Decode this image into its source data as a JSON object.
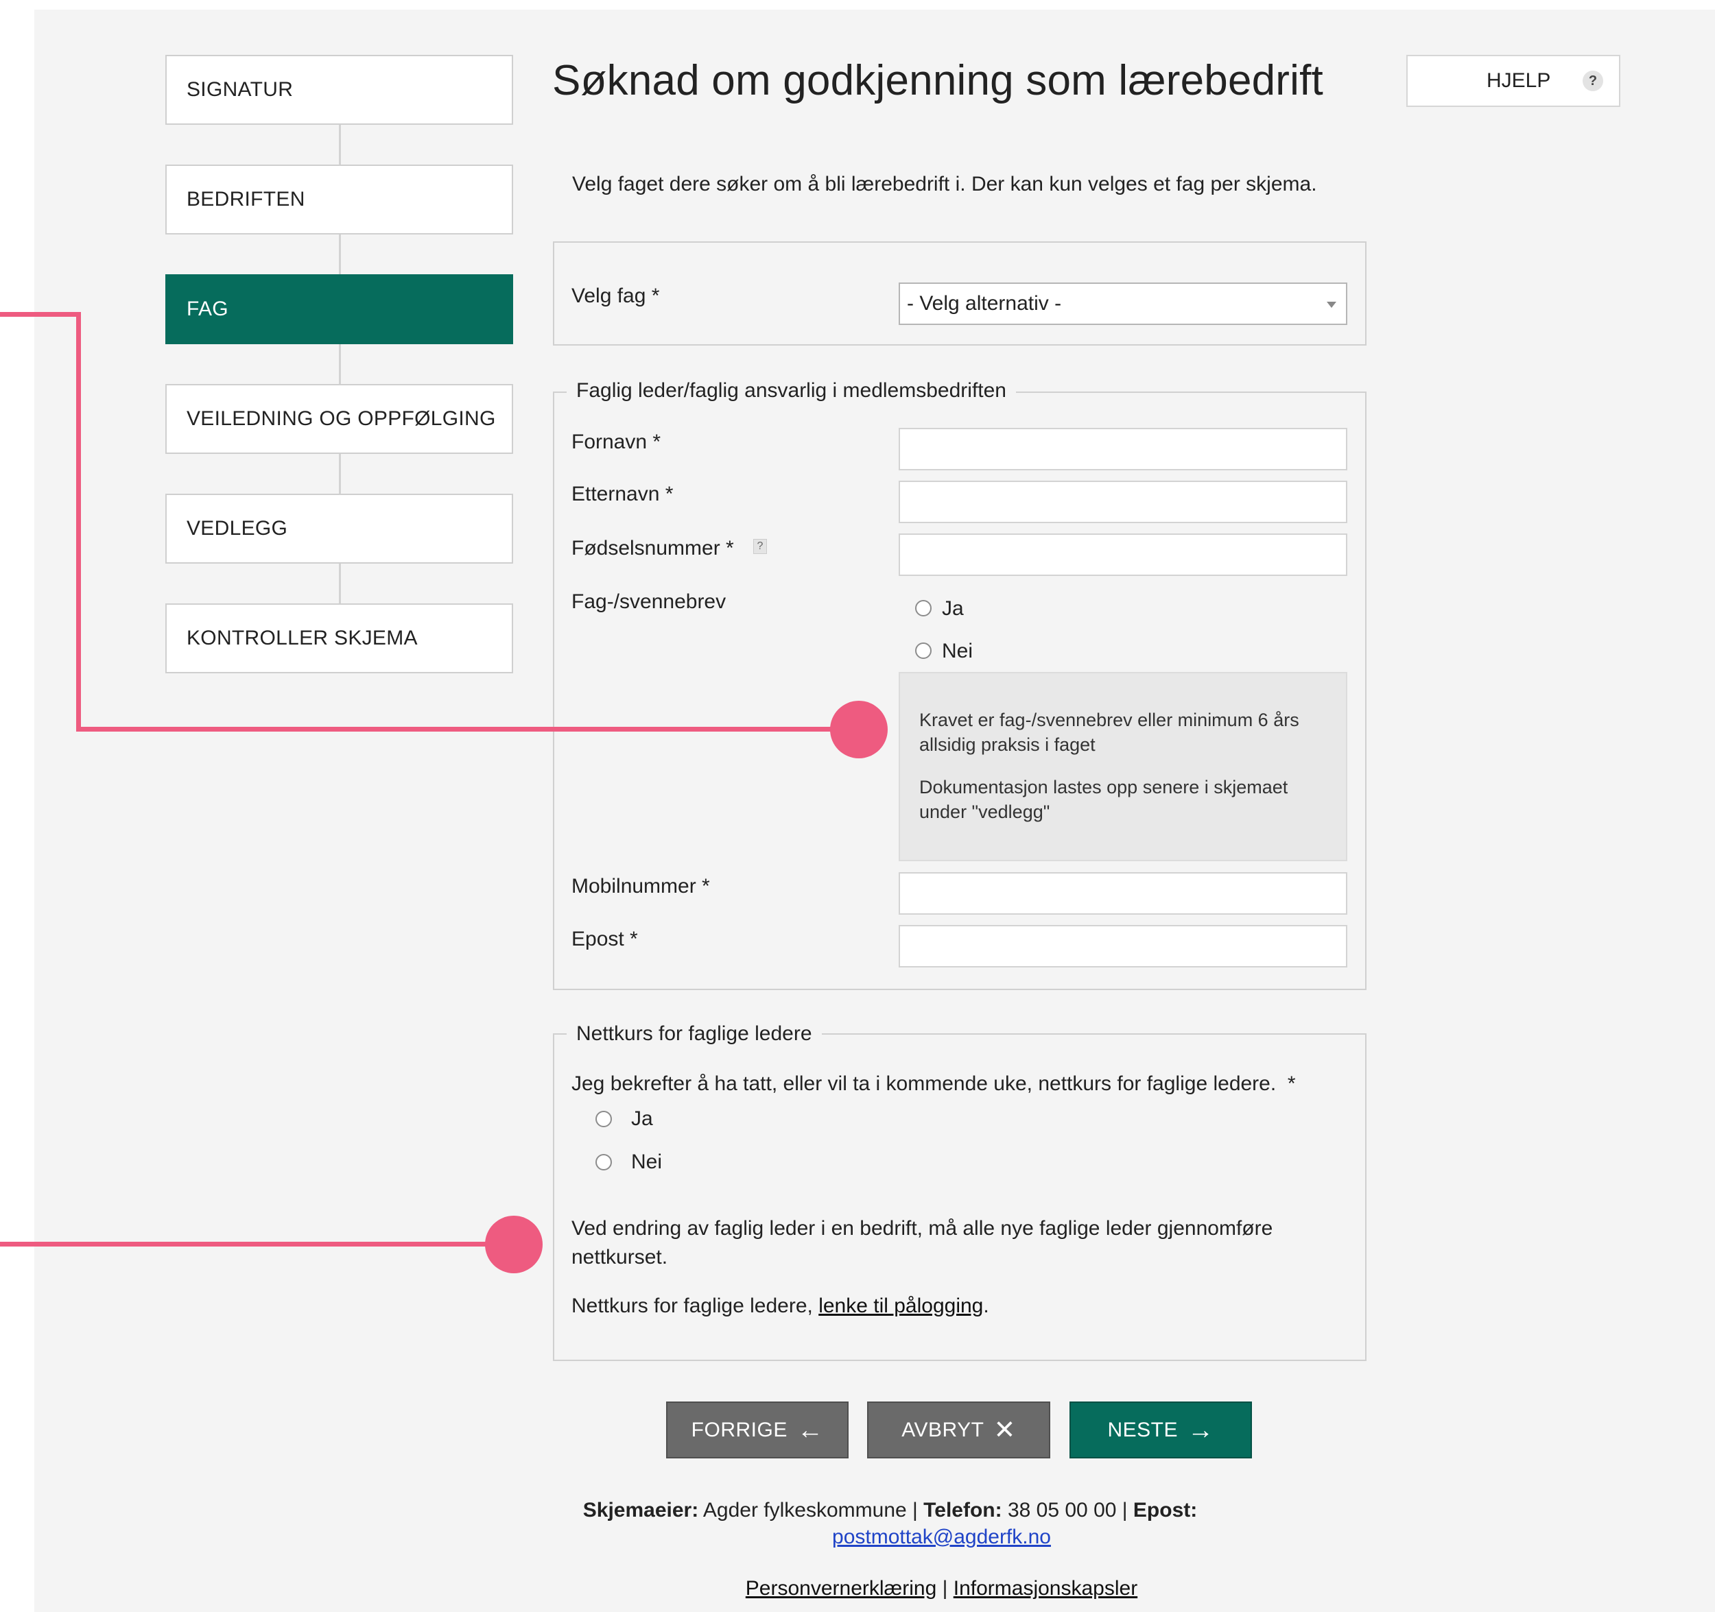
{
  "steps": [
    {
      "label": "SIGNATUR",
      "active": false
    },
    {
      "label": "BEDRIFTEN",
      "active": false
    },
    {
      "label": "FAG",
      "active": true
    },
    {
      "label": "VEILEDNING OG OPPFØLGING",
      "active": false
    },
    {
      "label": "VEDLEGG",
      "active": false
    },
    {
      "label": "KONTROLLER SKJEMA",
      "active": false
    }
  ],
  "page": {
    "title": "Søknad om godkjenning som lærebedrift",
    "help_label": "HJELP",
    "help_icon": "?",
    "intro": "Velg faget dere søker om å bli lærebedrift i. Der kan kun velges et fag per skjema."
  },
  "fag_select": {
    "label": "Velg fag *",
    "value": "- Velg alternativ -"
  },
  "leader_section": {
    "legend": "Faglig leder/faglig ansvarlig i medlemsbedriften",
    "fornavn_label": "Fornavn *",
    "fornavn_value": "",
    "etternavn_label": "Etternavn *",
    "etternavn_value": "",
    "fodselsnummer_label": "Fødselsnummer *",
    "fodselsnummer_help": "?",
    "fodselsnummer_value": "",
    "svennebrev_label": "Fag-/svennebrev",
    "option_yes": "Ja",
    "option_no": "Nei",
    "info_line1": "Kravet er fag-/svennebrev eller minimum 6 års allsidig praksis i faget",
    "info_line2": "Dokumentasjon lastes opp senere i skjemaet under \"vedlegg\"",
    "mobil_label": "Mobilnummer *",
    "mobil_value": "",
    "epost_label": "Epost *",
    "epost_value": ""
  },
  "course_section": {
    "legend": "Nettkurs for faglige ledere",
    "confirm_text": "Jeg bekrefter å ha tatt, eller vil ta i kommende uke, nettkurs for faglige ledere.  *",
    "option_yes": "Ja",
    "option_no": "Nei",
    "change_text": "Ved endring av faglig leder i en bedrift, må alle nye faglige leder gjennomføre nettkurset.",
    "link_prefix": "Nettkurs for faglige ledere, ",
    "link_text": "lenke til pålogging",
    "link_suffix": "."
  },
  "buttons": {
    "prev_label": "FORRIGE",
    "prev_icon": "←",
    "cancel_label": "AVBRYT",
    "cancel_icon": "✕",
    "next_label": "NESTE",
    "next_icon": "→"
  },
  "footer": {
    "owner_label": "Skjemaeier:",
    "owner_value": "Agder fylkeskommune",
    "sep": "|",
    "phone_label": "Telefon:",
    "phone_value": "38 05 00 00",
    "email_label": "Epost:",
    "email_value": "postmottak@agderfk.no",
    "privacy_link": "Personvernerklæring",
    "cookies_link": "Informasjonskapsler"
  },
  "colors": {
    "accent_green": "#066c5c",
    "button_gray": "#6a6a6a",
    "annotation_pink": "#ee5b80",
    "link_blue": "#1f43c7"
  }
}
